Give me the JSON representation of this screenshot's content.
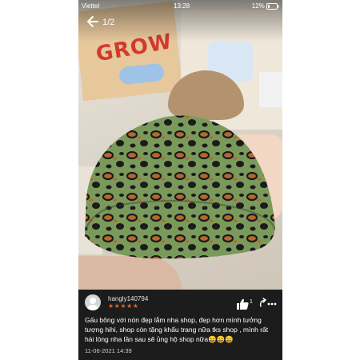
{
  "status_bar": {
    "carrier": "Viettel",
    "time": "13:28",
    "battery": "12%"
  },
  "viewer": {
    "counter": "1/2"
  },
  "photo_text": {
    "box_brand": "GROW"
  },
  "review": {
    "username": "hangly140794",
    "rating": "★★★★★",
    "text": "Gấu bông với nón đẹp lắm nha shop, đẹp hơn mình tưởng tượng hihi, shop còn tặng khẩu trang nữa tks shop , mình rất hài lòng nha lần sau sẽ ủng hộ shop nữa😄😄😄",
    "date": "11-06-2021 14:39",
    "like_count": "1"
  },
  "icons": [
    "back-arrow-icon",
    "like-icon",
    "more-icon",
    "signal-icon",
    "wifi-icon",
    "battery-icon"
  ],
  "colors": {
    "screen_bg": "#1c1c1c",
    "star": "#f05d23",
    "text": "#ffffff"
  }
}
